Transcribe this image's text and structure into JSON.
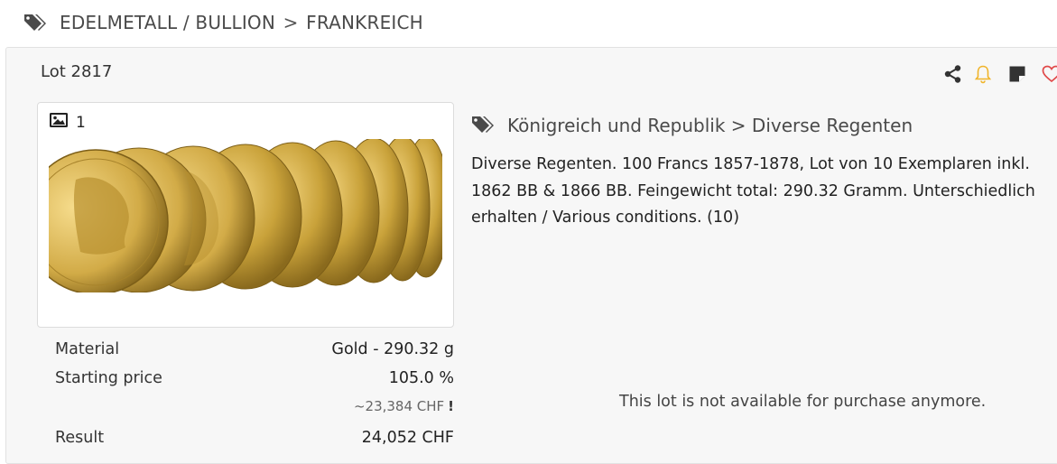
{
  "breadcrumb": {
    "icon": "tags-icon",
    "category": "EDELMETALL / BULLION",
    "separator": ">",
    "subcategory": "FRANKREICH"
  },
  "lot": {
    "label": "Lot 2817",
    "image_count": "1",
    "category_path": {
      "icon": "tags-icon",
      "parent": "Königreich und Republik",
      "separator": ">",
      "child": "Diverse Regenten"
    },
    "description_lines": [
      "Diverse Regenten. 100 Francs 1857-1878, Lot von 10 Exemplaren inkl.",
      "1862 BB & 1866 BB. Feingewicht total: 290.32 Gramm. Unterschiedlich",
      "erhalten / Various conditions. (10)"
    ],
    "facts": {
      "material_label": "Material",
      "material_value": "Gold - 290.32 g",
      "starting_label": "Starting price",
      "starting_value": "105.0 %",
      "starting_approx": "~23,384 CHF",
      "starting_approx_mark": "!",
      "result_label": "Result",
      "result_value": "24,052 CHF"
    },
    "status_text": "This lot is not available for purchase anymore."
  },
  "actions": [
    {
      "name": "share-icon"
    },
    {
      "name": "bell-icon",
      "color": "#f0b429"
    },
    {
      "name": "note-icon"
    },
    {
      "name": "heart-icon",
      "color": "#e04848"
    }
  ],
  "colors": {
    "panel_bg": "#f7f7f7",
    "text": "#333333",
    "gold": "#c9a23a"
  }
}
